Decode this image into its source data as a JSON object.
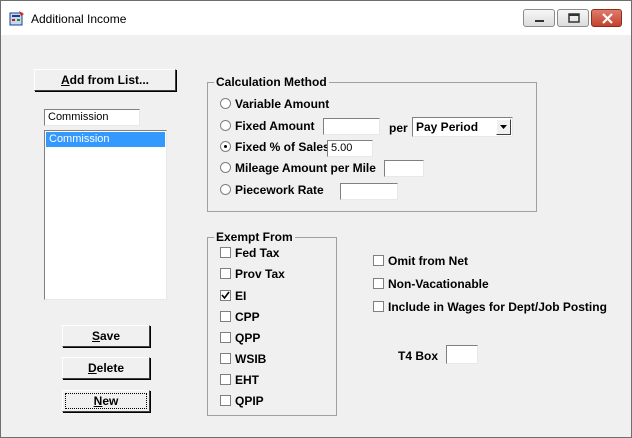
{
  "window": {
    "title": "Additional Income",
    "controls": {
      "minimize": "minimize-icon",
      "maximize": "maximize-icon",
      "close": "close-icon"
    }
  },
  "left": {
    "add_from_list_prefix": "A",
    "add_from_list_rest": "dd from List...",
    "income_name_value": "Commission",
    "list_items": [
      "Commission"
    ],
    "save_label_u": "S",
    "save_label_rest": "ave",
    "delete_label_u": "D",
    "delete_label_rest": "elete",
    "new_label_u": "N",
    "new_label_rest": "ew"
  },
  "calc": {
    "legend": "Calculation Method",
    "variable_amount": "Variable Amount",
    "fixed_amount": "Fixed Amount",
    "fixed_amount_value": "",
    "per_label": "per",
    "per_selected": "Pay Period",
    "fixed_pct_sales": "Fixed % of Sales",
    "fixed_pct_value": "5.00",
    "mileage": "Mileage Amount per Mile",
    "mileage_value": "",
    "piecework": "Piecework Rate",
    "piecework_value": "",
    "selected": "fixed_pct_sales"
  },
  "exempt": {
    "legend": "Exempt From",
    "items": [
      {
        "label": "Fed Tax",
        "checked": false
      },
      {
        "label": "Prov Tax",
        "checked": false
      },
      {
        "label": "EI",
        "checked": true
      },
      {
        "label": "CPP",
        "checked": false
      },
      {
        "label": "QPP",
        "checked": false
      },
      {
        "label": "WSIB",
        "checked": false
      },
      {
        "label": "EHT",
        "checked": false
      },
      {
        "label": "QPIP",
        "checked": false
      }
    ]
  },
  "options": {
    "omit_from_net": "Omit from Net",
    "non_vacationable": "Non-Vacationable",
    "include_wages": "Include in Wages for Dept/Job Posting",
    "t4_box_label": "T4 Box",
    "t4_box_value": ""
  }
}
